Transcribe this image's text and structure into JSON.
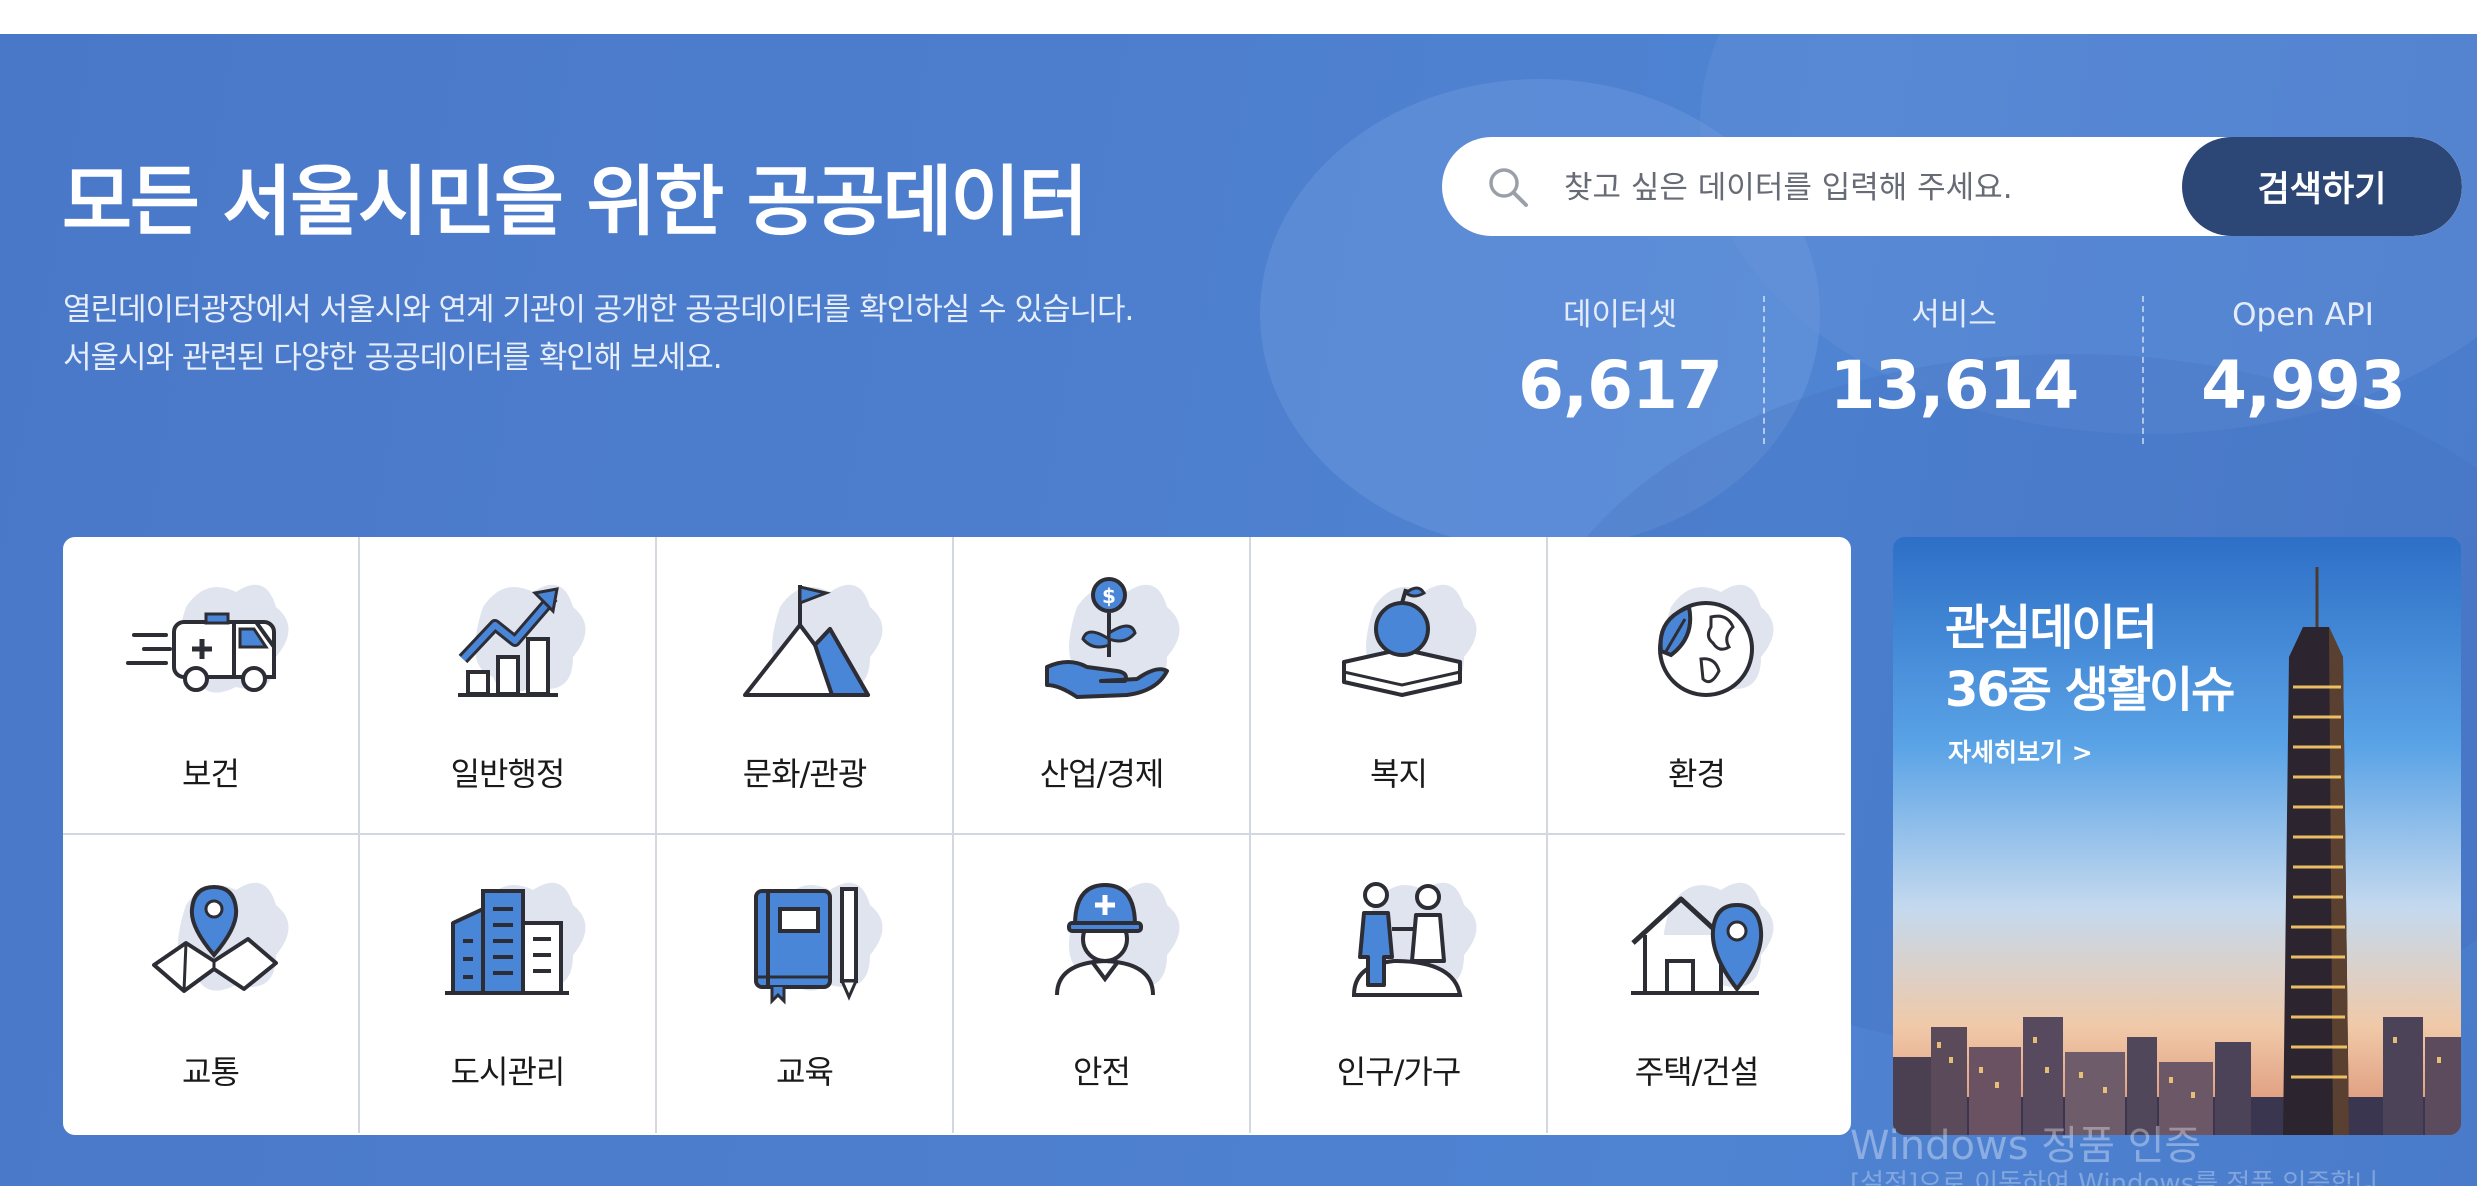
{
  "hero": {
    "title": "모든 서울시민을 위한 공공데이터",
    "subtitle_line1": "열린데이터광장에서 서울시와 연계 기관이 공개한 공공데이터를 확인하실 수 있습니다.",
    "subtitle_line2": "서울시와 관련된 다양한 공공데이터를 확인해 보세요."
  },
  "search": {
    "placeholder": "찾고 싶은 데이터를 입력해 주세요.",
    "button_label": "검색하기",
    "icon": "search-icon"
  },
  "stats": [
    {
      "label": "데이터셋",
      "value": "6,617"
    },
    {
      "label": "서비스",
      "value": "13,614"
    },
    {
      "label": "Open API",
      "value": "4,993"
    }
  ],
  "categories": [
    {
      "label": "보건",
      "icon": "ambulance-icon"
    },
    {
      "label": "일반행정",
      "icon": "growth-chart-icon"
    },
    {
      "label": "문화/관광",
      "icon": "mountain-flag-icon"
    },
    {
      "label": "산업/경제",
      "icon": "money-plant-hand-icon"
    },
    {
      "label": "복지",
      "icon": "apple-book-icon"
    },
    {
      "label": "환경",
      "icon": "earth-leaf-icon"
    },
    {
      "label": "교통",
      "icon": "map-pin-icon"
    },
    {
      "label": "도시관리",
      "icon": "city-buildings-icon"
    },
    {
      "label": "교육",
      "icon": "book-pencil-icon"
    },
    {
      "label": "안전",
      "icon": "safety-worker-icon"
    },
    {
      "label": "인구/가구",
      "icon": "family-people-icon"
    },
    {
      "label": "주택/건설",
      "icon": "house-pin-icon"
    }
  ],
  "banner": {
    "title_line1": "관심데이터",
    "title_line2": "36종 생활이슈",
    "more_label": "자세히보기 >"
  },
  "watermark": {
    "line1": "Windows 정품 인증",
    "line2": "[설정]으로 이동하여 Windows를 정품 인증합니"
  },
  "colors": {
    "hero_blue": "#4d7fce",
    "search_button": "#2c4675",
    "icon_blue": "#4a86d8",
    "icon_outline": "#2d2d35",
    "map_shape": "#dfe4ee"
  }
}
